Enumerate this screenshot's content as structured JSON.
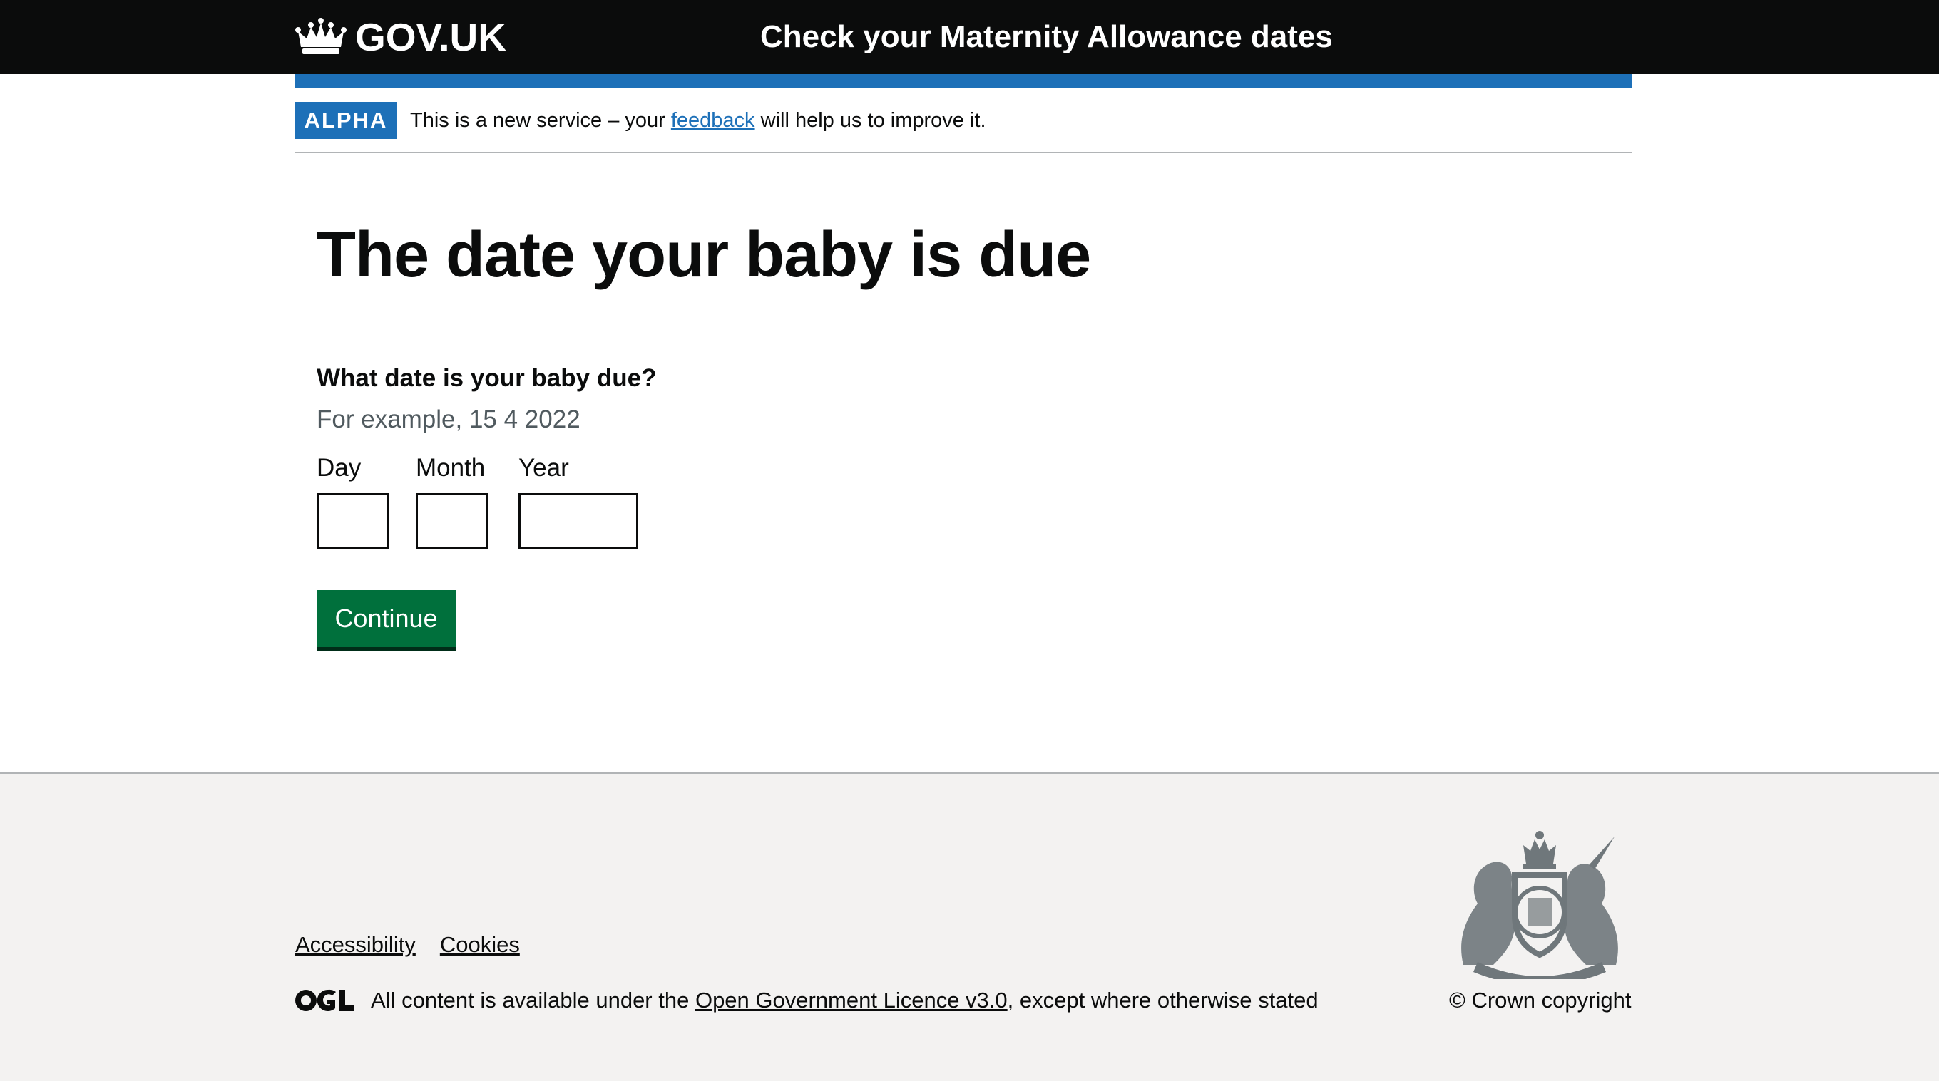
{
  "header": {
    "logo_text": "GOV.UK",
    "service_name": "Check your Maternity Allowance dates"
  },
  "phase_banner": {
    "tag": "ALPHA",
    "text_before": "This is a new service – your ",
    "link": "feedback",
    "text_after": " will help us to improve it."
  },
  "main": {
    "title": "The date your baby is due",
    "question": "What date is your baby due?",
    "hint": "For example, 15 4 2022",
    "date_fields": {
      "day": {
        "label": "Day",
        "value": ""
      },
      "month": {
        "label": "Month",
        "value": ""
      },
      "year": {
        "label": "Year",
        "value": ""
      }
    },
    "continue_label": "Continue"
  },
  "footer": {
    "links": [
      "Accessibility",
      "Cookies"
    ],
    "licence_before": "All content is available under the ",
    "licence_link": "Open Government Licence v3.0",
    "licence_after": ", except where otherwise stated",
    "copyright": "© Crown copyright",
    "icons": [
      "crown-icon",
      "ogl-logo-icon",
      "royal-crest-icon"
    ]
  },
  "colors": {
    "header_bg": "#0b0c0c",
    "brand_blue": "#1d70b8",
    "button_green": "#00703c",
    "footer_bg": "#f3f2f1",
    "hint_grey": "#505a5f"
  }
}
